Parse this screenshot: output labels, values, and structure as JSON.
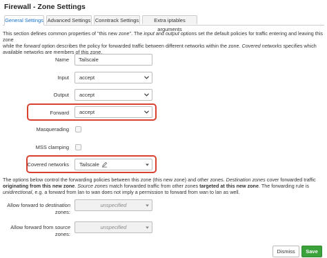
{
  "page_title": "Firewall - Zone Settings",
  "tabs": [
    {
      "label": "General Settings",
      "active": true
    },
    {
      "label": "Advanced Settings",
      "active": false
    },
    {
      "label": "Conntrack Settings",
      "active": false
    },
    {
      "label": "Extra iptables arguments",
      "active": false
    }
  ],
  "section1": {
    "line1_a": "This section defines common properties of \"this new zone\". The ",
    "input_word": "input",
    "and_word": " and ",
    "output_word": "output",
    "line1_b": " options set the default policies for traffic entering and leaving this zone",
    "line2_a": "while the ",
    "forward_word": "forward",
    "line2_b": " option describes the policy for forwarded traffic between different networks within the zone. ",
    "covered_word": "Covered networks",
    "line2_c": " specifies which",
    "line3": "available networks are members of this zone."
  },
  "fields": {
    "name": {
      "label": "Name",
      "value": "Tailscale"
    },
    "input": {
      "label": "Input",
      "value": "accept"
    },
    "output": {
      "label": "Output",
      "value": "accept"
    },
    "forward": {
      "label": "Forward",
      "value": "accept"
    },
    "masquerading": {
      "label": "Masquerading",
      "checked": false
    },
    "mss_clamping": {
      "label": "MSS clamping",
      "checked": false
    },
    "covered_networks": {
      "label": "Covered networks",
      "tag": "Tailscale"
    }
  },
  "section2": {
    "p1_a": "The options below control the forwarding policies between this zone (this new zone) and other zones. ",
    "dest_zones_word": "Destination zones",
    "p1_b": " cover forwarded traffic",
    "p2_bold1": "originating from this new zone",
    "p2_a": ". ",
    "source_zones_word": "Source zones",
    "p2_b": " match forwarded traffic from other zones ",
    "p2_bold2": "targeted at this new zone",
    "p2_c": ". The forwarding rule is",
    "unidirectional_word": "unidirectional",
    "p3": ", e.g. a forward from lan to wan does not imply a permission to forward from wan to lan as well."
  },
  "forwarding": {
    "dest_label_pre": "Allow forward to ",
    "dest_label_italic": "destination",
    "dest_label_line2": "zones:",
    "dest_value": "unspecified",
    "src_label_pre": "Allow forward from ",
    "src_label_italic": "source",
    "src_label_line2": "zones:",
    "src_value": "unspecified"
  },
  "footer": {
    "dismiss": "Dismiss",
    "save": "Save"
  },
  "colors": {
    "highlight": "#d9412f",
    "save": "#3aa13b",
    "active_tab": "#1a73c9"
  }
}
